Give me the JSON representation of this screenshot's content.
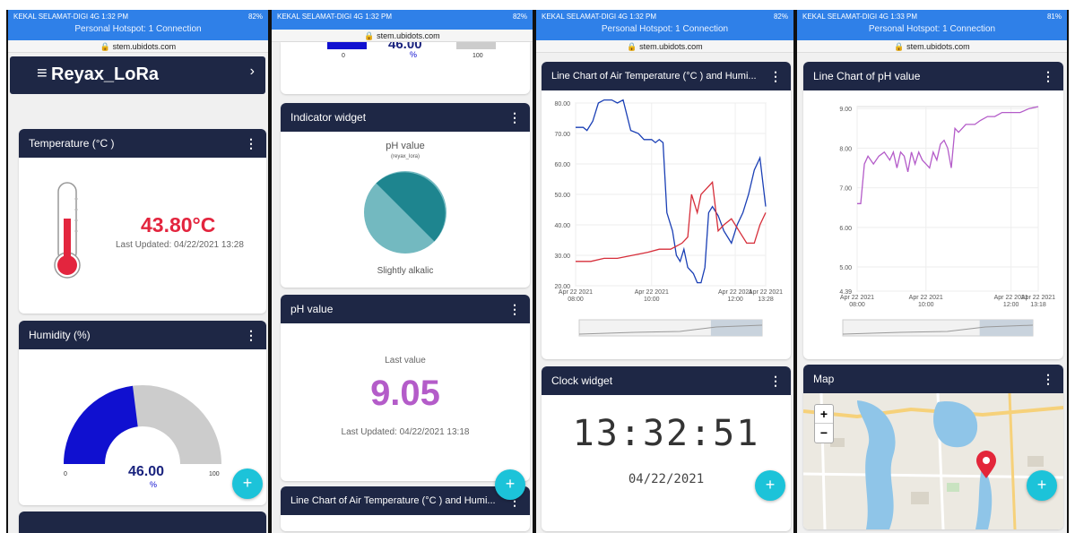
{
  "status": {
    "p1": {
      "carrier": "KEKAL SELAMAT-DIGI  4G  1:32 PM",
      "batt": "82%",
      "hotspot": "Personal Hotspot: 1 Connection"
    },
    "p2": {
      "carrier": "KEKAL SELAMAT-DIGI  4G  1:32 PM",
      "batt": "82%",
      "hotspot": ""
    },
    "p3": {
      "carrier": "KEKAL SELAMAT-DIGI  4G  1:32 PM",
      "batt": "82%",
      "hotspot": "Personal Hotspot: 1 Connection"
    },
    "p4": {
      "carrier": "KEKAL SELAMAT-DIGI  4G  1:33 PM",
      "batt": "81%",
      "hotspot": "Personal Hotspot: 1 Connection"
    },
    "url": "stem.ubidots.com"
  },
  "header": {
    "title": "Reyax_LoRa",
    "menu_icon": "hamburger-icon",
    "chevron": "›"
  },
  "temperature": {
    "title": "Temperature (°C )",
    "value": "43.80°C",
    "updated": "Last Updated: 04/22/2021 13:28"
  },
  "humidity": {
    "title": "Humidity (%)",
    "value": "46.00",
    "unit": "%",
    "min": "0",
    "max": "100",
    "fraction": 0.46
  },
  "top_gauge": {
    "value": "46.00",
    "unit": "%",
    "min": "0",
    "max": "100"
  },
  "indicator": {
    "title": "Indicator widget",
    "label": "pH value",
    "sublabel": "(reyax_lora)",
    "state": "Slightly alkalic"
  },
  "ph": {
    "title": "pH value",
    "label": "Last value",
    "value": "9.05",
    "updated": "Last Updated: 04/22/2021 13:18"
  },
  "line_air_title": "Line Chart of Air Temperature (°C ) and Humi...",
  "clock": {
    "title": "Clock widget",
    "time": "13:32:51",
    "date": "04/22/2021"
  },
  "ph_chart_title": "Line Chart of pH value",
  "map": {
    "title": "Map",
    "zoom_in": "+",
    "zoom_out": "−"
  },
  "fab_label": "+",
  "kebab": "⋮",
  "chart_data": [
    {
      "type": "line",
      "title": "Line Chart of Air Temperature (°C ) and Humi...",
      "x_ticks": [
        "Apr 22 2021 08:00",
        "Apr 22 2021 10:00",
        "Apr 22 2021 12:00",
        "Apr 22 2021 13:28"
      ],
      "y_ticks": [
        "80.00",
        "70.00",
        "60.00",
        "50.00",
        "40.00",
        "30.00",
        "20.00"
      ],
      "ylim": [
        20,
        80
      ],
      "series": [
        {
          "color": "#1a3fb5",
          "x": [
            0,
            4,
            6,
            9,
            12,
            15,
            19,
            22,
            25,
            29,
            33,
            36,
            40,
            42,
            44,
            46,
            48,
            51,
            53,
            55,
            57,
            59,
            62,
            64,
            66,
            68,
            70,
            72,
            75,
            78,
            82,
            85,
            88,
            91,
            94,
            97,
            100
          ],
          "values": [
            72,
            72,
            71,
            74,
            80,
            81,
            81,
            80,
            81,
            71,
            70,
            68,
            68,
            67,
            68,
            67,
            44,
            38,
            30,
            28,
            32,
            26,
            24,
            21,
            21,
            26,
            44,
            46,
            43,
            38,
            34,
            40,
            44,
            50,
            58,
            62,
            46
          ]
        },
        {
          "color": "#d62e3a",
          "x": [
            0,
            8,
            15,
            22,
            30,
            38,
            44,
            50,
            53,
            56,
            59,
            61,
            64,
            66,
            69,
            72,
            75,
            78,
            82,
            86,
            90,
            94,
            97,
            100
          ],
          "values": [
            28,
            28,
            29,
            29,
            30,
            31,
            32,
            32,
            33,
            34,
            36,
            50,
            44,
            50,
            52,
            54,
            38,
            40,
            42,
            38,
            34,
            34,
            40,
            44
          ]
        }
      ]
    },
    {
      "type": "line",
      "title": "Line Chart of pH value",
      "x_ticks": [
        "Apr 22 2021 08:00",
        "Apr 22 2021 10:00",
        "Apr 22 2021 12:00",
        "Apr 22 2021 13:18"
      ],
      "y_ticks": [
        "9.00",
        "8.00",
        "7.00",
        "6.00",
        "5.00",
        "4.39"
      ],
      "ylim": [
        4.39,
        9.05
      ],
      "series": [
        {
          "color": "#b45cc9",
          "x": [
            0,
            2,
            4,
            6,
            9,
            12,
            15,
            18,
            20,
            22,
            24,
            26,
            28,
            30,
            32,
            34,
            36,
            38,
            40,
            42,
            44,
            46,
            48,
            50,
            52,
            54,
            56,
            58,
            60,
            62,
            65,
            68,
            72,
            76,
            80,
            85,
            90,
            95,
            100
          ],
          "values": [
            6.6,
            6.6,
            7.6,
            7.8,
            7.6,
            7.8,
            7.9,
            7.7,
            7.9,
            7.5,
            7.9,
            7.8,
            7.4,
            7.9,
            7.6,
            7.9,
            7.7,
            7.6,
            7.5,
            7.9,
            7.7,
            8.1,
            8.2,
            8.0,
            7.5,
            8.5,
            8.4,
            8.5,
            8.6,
            8.6,
            8.6,
            8.7,
            8.8,
            8.8,
            8.9,
            8.9,
            8.9,
            9.0,
            9.05
          ]
        }
      ]
    }
  ]
}
